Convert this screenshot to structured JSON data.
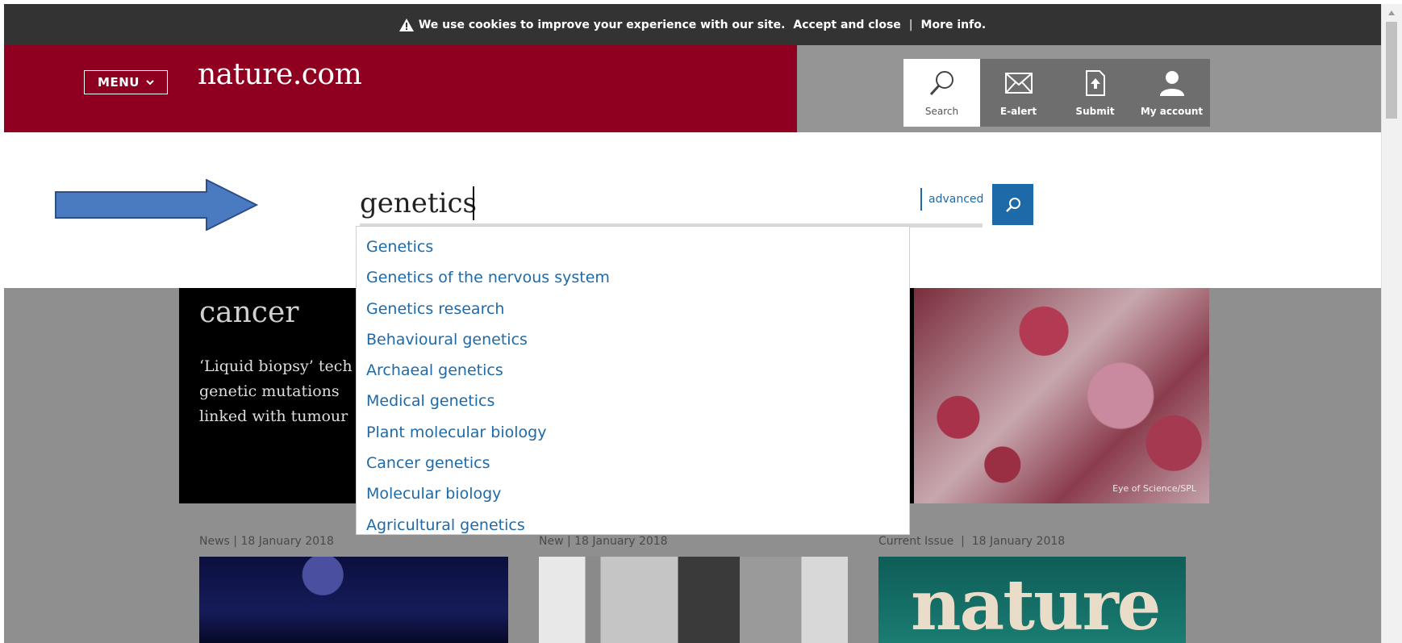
{
  "cookie_bar": {
    "message": "We use cookies to improve your experience with our site.",
    "accept": "Accept and close",
    "separator": "|",
    "more_info": "More info."
  },
  "header": {
    "menu_label": "MENU",
    "logo": "nature.com",
    "tools": [
      {
        "label": "Search",
        "icon": "search-icon"
      },
      {
        "label": "E-alert",
        "icon": "envelope-icon"
      },
      {
        "label": "Submit",
        "icon": "upload-icon"
      },
      {
        "label": "My account",
        "icon": "user-icon"
      }
    ]
  },
  "search": {
    "value": "genetics",
    "advanced_label": "advanced",
    "suggestions": [
      "Genetics",
      "Genetics of the nervous system",
      "Genetics research",
      "Behavioural genetics",
      "Archaeal genetics",
      "Medical genetics",
      "Plant molecular biology",
      "Cancer genetics",
      "Molecular biology",
      "Agricultural genetics"
    ]
  },
  "hero": {
    "title": "cancer",
    "text": "‘Liquid biopsy’ tech genetic mutations linked with tumour",
    "image_credit": "Eye of Science/SPL"
  },
  "news": [
    {
      "meta": "News | 18 January 2018"
    },
    {
      "meta": "New | 18 January 2018"
    },
    {
      "meta": "Current Issue  |  18 January 2018",
      "cover_title": "nature"
    }
  ],
  "colors": {
    "brand": "#8f0020",
    "link": "#1e6aa8",
    "cookie_bar": "#333333",
    "arrow": "#4a7ac0"
  }
}
